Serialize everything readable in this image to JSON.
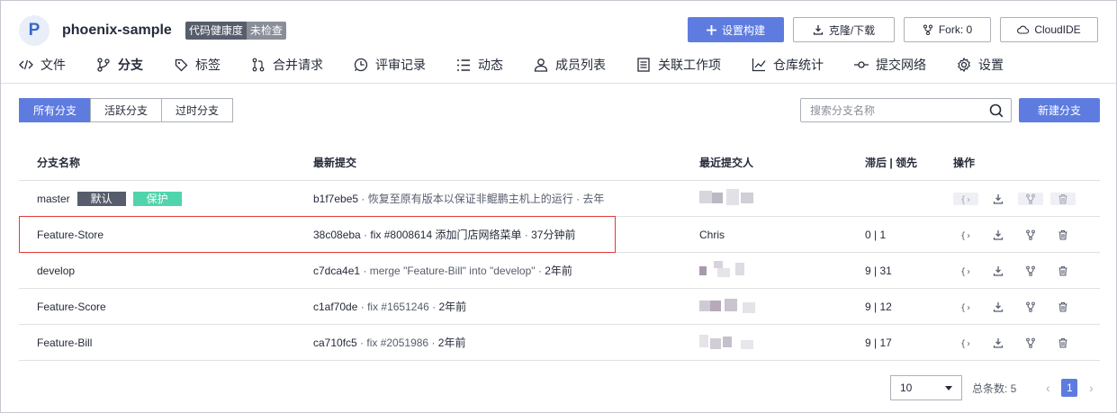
{
  "repo": {
    "avatar_letter": "P",
    "name": "phoenix-sample",
    "health_label": "代码健康度",
    "health_value": "未检查"
  },
  "header_actions": {
    "build": "设置构建",
    "clone": "克隆/下载",
    "fork": "Fork: 0",
    "cloudide": "CloudIDE"
  },
  "nav": [
    {
      "label": "文件",
      "icon": "code-icon"
    },
    {
      "label": "分支",
      "icon": "branch-icon",
      "active": true
    },
    {
      "label": "标签",
      "icon": "tag-icon"
    },
    {
      "label": "合并请求",
      "icon": "merge-request-icon"
    },
    {
      "label": "评审记录",
      "icon": "review-icon"
    },
    {
      "label": "动态",
      "icon": "activity-icon"
    },
    {
      "label": "成员列表",
      "icon": "members-icon"
    },
    {
      "label": "关联工作项",
      "icon": "workitem-icon"
    },
    {
      "label": "仓库统计",
      "icon": "stats-icon"
    },
    {
      "label": "提交网络",
      "icon": "commit-network-icon"
    },
    {
      "label": "设置",
      "icon": "settings-icon"
    }
  ],
  "filters": [
    "所有分支",
    "活跃分支",
    "过时分支"
  ],
  "search_placeholder": "搜索分支名称",
  "new_branch": "新建分支",
  "table": {
    "headers": [
      "分支名称",
      "最新提交",
      "最近提交人",
      "滞后 | 领先",
      "操作"
    ],
    "rows": [
      {
        "name": "master",
        "badges": [
          "默认",
          "保护"
        ],
        "commit": "b1f7ebe5",
        "message": "恢复至原有版本以保证非鲲鹏主机上的运行",
        "time": "去年",
        "committer": "",
        "behind_ahead": ""
      },
      {
        "name": "Feature-Store",
        "badges": [],
        "commit": "38c08eba",
        "message": "fix #8008614 添加门店网络菜单",
        "time": "37分钟前",
        "committer": "Chris",
        "behind_ahead": "0  |  1"
      },
      {
        "name": "develop",
        "badges": [],
        "commit": "c7dca4e1",
        "message": "merge \"Feature-Bill\" into \"develop\"",
        "time": "2年前",
        "committer": "",
        "behind_ahead": "9  |  31"
      },
      {
        "name": "Feature-Score",
        "badges": [],
        "commit": "c1af70de",
        "message": "fix #1651246",
        "time": "2年前",
        "committer": "",
        "behind_ahead": "9  |  12"
      },
      {
        "name": "Feature-Bill",
        "badges": [],
        "commit": "ca710fc5",
        "message": "fix #2051986",
        "time": "2年前",
        "committer": "",
        "behind_ahead": "9  |  17"
      }
    ]
  },
  "pagination": {
    "page_size": "10",
    "total_label": "总条数: 5",
    "current_page": "1"
  },
  "colors": {
    "primary": "#5e7ce0",
    "protect": "#50d4ab",
    "default_badge": "#575d6c",
    "highlight": "#e03b3b"
  }
}
